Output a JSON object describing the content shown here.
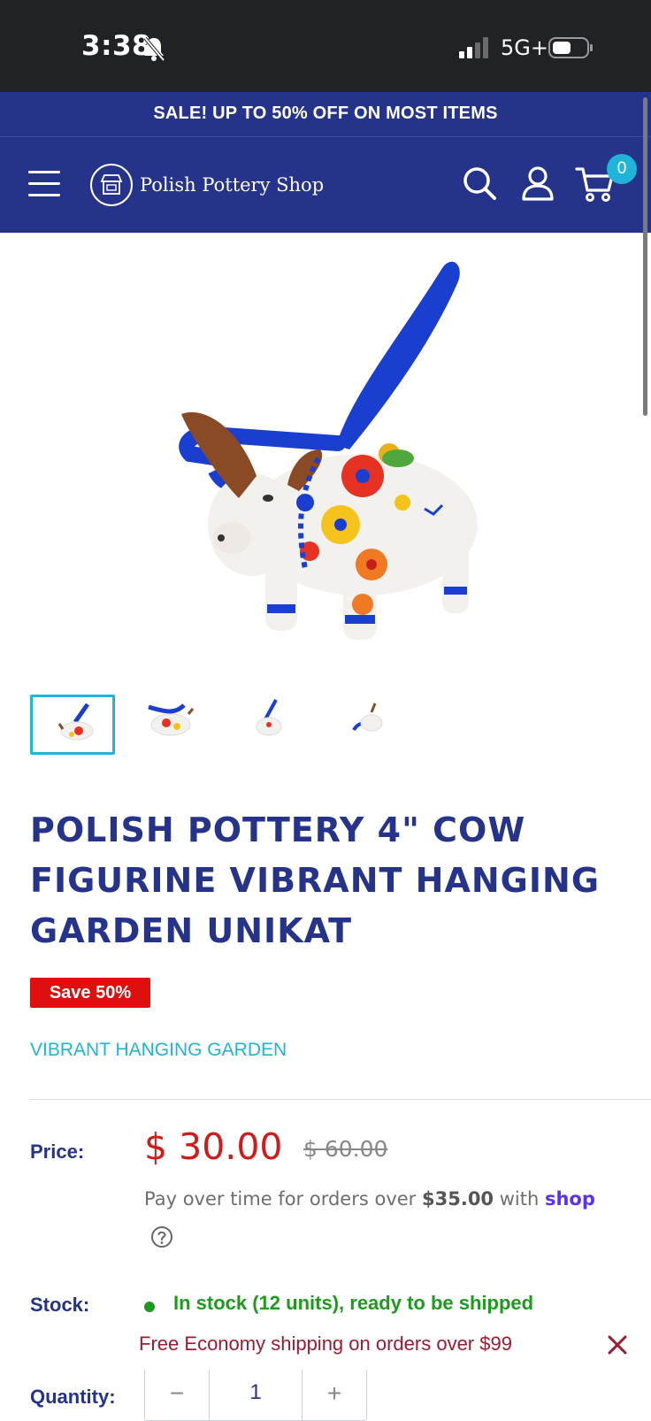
{
  "status_bar": {
    "time": "3:38",
    "network": "5G+"
  },
  "promo_banner": {
    "text": "SALE! UP TO 50% OFF ON MOST ITEMS"
  },
  "header": {
    "logo_text": "Polish Pottery Shop",
    "cart_count": "0"
  },
  "icons": {
    "menu": "menu-icon",
    "search": "search-icon",
    "account": "user-icon",
    "cart": "cart-icon",
    "help": "question-icon",
    "close": "close-icon"
  },
  "product": {
    "title": "POLISH POTTERY 4\" COW FIGURINE VIBRANT HANGING GARDEN UNIKAT",
    "save_badge": "Save 50%",
    "collection": "VIBRANT HANGING GARDEN",
    "thumbnails": [
      {
        "active": true
      },
      {
        "active": false
      },
      {
        "active": false
      },
      {
        "active": false
      }
    ]
  },
  "pricing": {
    "price_label": "Price:",
    "current_price": "$ 30.00",
    "original_price": "$ 60.00",
    "pay_over_prefix": "Pay over time for orders over ",
    "pay_over_amount": "$35.00",
    "pay_over_suffix": " with ",
    "shop_brand": "shop"
  },
  "stock": {
    "label": "Stock:",
    "text": "In stock (12 units), ready to be shipped"
  },
  "shipping_notice": {
    "text": "Free Economy shipping on orders over $99"
  },
  "quantity": {
    "label": "Quantity:",
    "value": "1",
    "minus": "−",
    "plus": "+"
  },
  "colors": {
    "brand_navy": "#26338a",
    "accent_cyan": "#1fb5d8",
    "sale_red": "#e00f0f",
    "stock_green": "#1e9a1e"
  }
}
